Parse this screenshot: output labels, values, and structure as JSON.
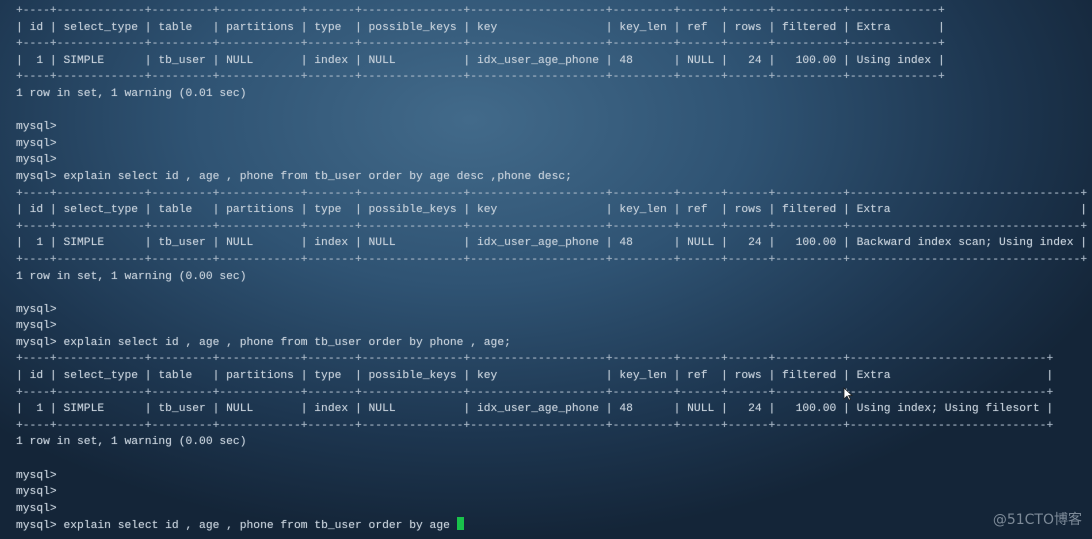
{
  "terminal": {
    "prompt": "mysql>",
    "blocks": [
      {
        "type": "table",
        "columns": [
          "id",
          "select_type",
          "table",
          "partitions",
          "type",
          "possible_keys",
          "key",
          "key_len",
          "ref",
          "rows",
          "filtered",
          "Extra"
        ],
        "rows": [
          [
            "1",
            "SIMPLE",
            "tb_user",
            "NULL",
            "index",
            "NULL",
            "idx_user_age_phone",
            "48",
            "NULL",
            "24",
            "100.00",
            "Using index"
          ]
        ]
      },
      {
        "type": "text",
        "text": "1 row in set, 1 warning (0.01 sec)"
      },
      {
        "type": "blank"
      },
      {
        "type": "prompt",
        "command": ""
      },
      {
        "type": "prompt",
        "command": ""
      },
      {
        "type": "prompt",
        "command": ""
      },
      {
        "type": "prompt",
        "command": "explain select id , age , phone from tb_user order by age desc ,phone desc;"
      },
      {
        "type": "table",
        "columns": [
          "id",
          "select_type",
          "table",
          "partitions",
          "type",
          "possible_keys",
          "key",
          "key_len",
          "ref",
          "rows",
          "filtered",
          "Extra"
        ],
        "rows": [
          [
            "1",
            "SIMPLE",
            "tb_user",
            "NULL",
            "index",
            "NULL",
            "idx_user_age_phone",
            "48",
            "NULL",
            "24",
            "100.00",
            "Backward index scan; Using index"
          ]
        ]
      },
      {
        "type": "text",
        "text": "1 row in set, 1 warning (0.00 sec)"
      },
      {
        "type": "blank"
      },
      {
        "type": "prompt",
        "command": ""
      },
      {
        "type": "prompt",
        "command": ""
      },
      {
        "type": "prompt",
        "command": "explain select id , age , phone from tb_user order by phone , age;"
      },
      {
        "type": "table",
        "columns": [
          "id",
          "select_type",
          "table",
          "partitions",
          "type",
          "possible_keys",
          "key",
          "key_len",
          "ref",
          "rows",
          "filtered",
          "Extra"
        ],
        "rows": [
          [
            "1",
            "SIMPLE",
            "tb_user",
            "NULL",
            "index",
            "NULL",
            "idx_user_age_phone",
            "48",
            "NULL",
            "24",
            "100.00",
            "Using index; Using filesort"
          ]
        ]
      },
      {
        "type": "text",
        "text": "1 row in set, 1 warning (0.00 sec)"
      },
      {
        "type": "blank"
      },
      {
        "type": "prompt",
        "command": ""
      },
      {
        "type": "prompt",
        "command": ""
      },
      {
        "type": "prompt",
        "command": ""
      },
      {
        "type": "prompt",
        "command": "explain select id , age , phone from tb_user order by age ",
        "cursor": true
      }
    ]
  },
  "right_aligned_columns": [
    "id",
    "rows",
    "filtered"
  ],
  "cursor_color": "#19c24b",
  "watermark": "@51CTO博客"
}
